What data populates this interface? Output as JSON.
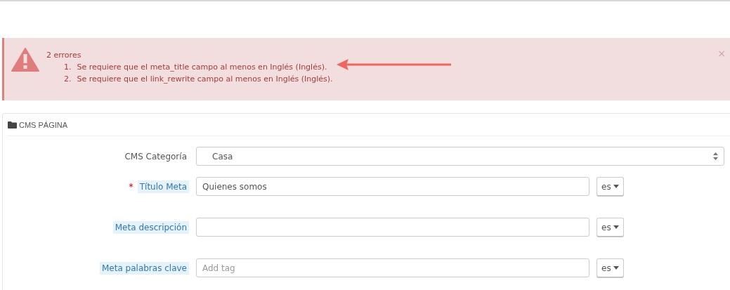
{
  "alert": {
    "title": "2 errores",
    "close": "×",
    "errors": [
      {
        "number": "1.",
        "text": "Se requiere que el meta_title campo al menos en Inglés (Inglés)."
      },
      {
        "number": "2.",
        "text": "Se requiere que el link_rewrite campo al menos en Inglés (Inglés)."
      }
    ]
  },
  "panel": {
    "title": "CMS PÁGINA",
    "fields": [
      {
        "kind": "select",
        "label": "CMS Categoría",
        "hint": false,
        "value": "Casa"
      },
      {
        "kind": "text",
        "label": "Título Meta",
        "required_mark": "*",
        "hint": true,
        "value": "Quienes somos",
        "language": "es"
      },
      {
        "kind": "text",
        "label": "Meta descripción",
        "hint": true,
        "language": "es"
      },
      {
        "kind": "tags",
        "label": "Meta palabras clave",
        "hint": true,
        "placeholder": "Add tag",
        "language": "es"
      }
    ]
  }
}
